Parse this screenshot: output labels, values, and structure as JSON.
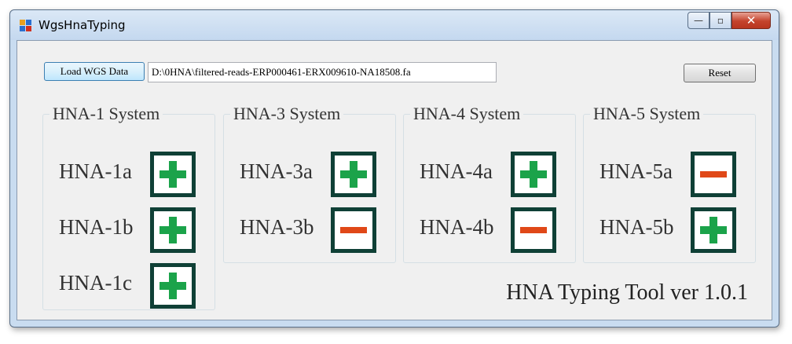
{
  "window": {
    "title": "WgsHnaTyping",
    "minimize_glyph": "—",
    "maximize_glyph": "▫",
    "close_glyph": "✕"
  },
  "toolbar": {
    "load_label": "Load WGS Data",
    "path_value": "D:\\0HNA\\filtered-reads-ERP000461-ERX009610-NA18508.fa",
    "reset_label": "Reset"
  },
  "groups": [
    {
      "title": "HNA-1 System",
      "items": [
        {
          "label": "HNA-1a",
          "result": "positive"
        },
        {
          "label": "HNA-1b",
          "result": "positive"
        },
        {
          "label": "HNA-1c",
          "result": "positive"
        }
      ]
    },
    {
      "title": "HNA-3 System",
      "items": [
        {
          "label": "HNA-3a",
          "result": "positive"
        },
        {
          "label": "HNA-3b",
          "result": "negative"
        }
      ]
    },
    {
      "title": "HNA-4 System",
      "items": [
        {
          "label": "HNA-4a",
          "result": "positive"
        },
        {
          "label": "HNA-4b",
          "result": "negative"
        }
      ]
    },
    {
      "title": "HNA-5 System",
      "items": [
        {
          "label": "HNA-5a",
          "result": "negative"
        },
        {
          "label": "HNA-5b",
          "result": "positive"
        }
      ]
    }
  ],
  "footer": {
    "version": "HNA Typing Tool ver 1.0.1"
  },
  "colors": {
    "positive": "#1ba34a",
    "negative": "#e04818",
    "indicator_border": "#0f4036"
  }
}
